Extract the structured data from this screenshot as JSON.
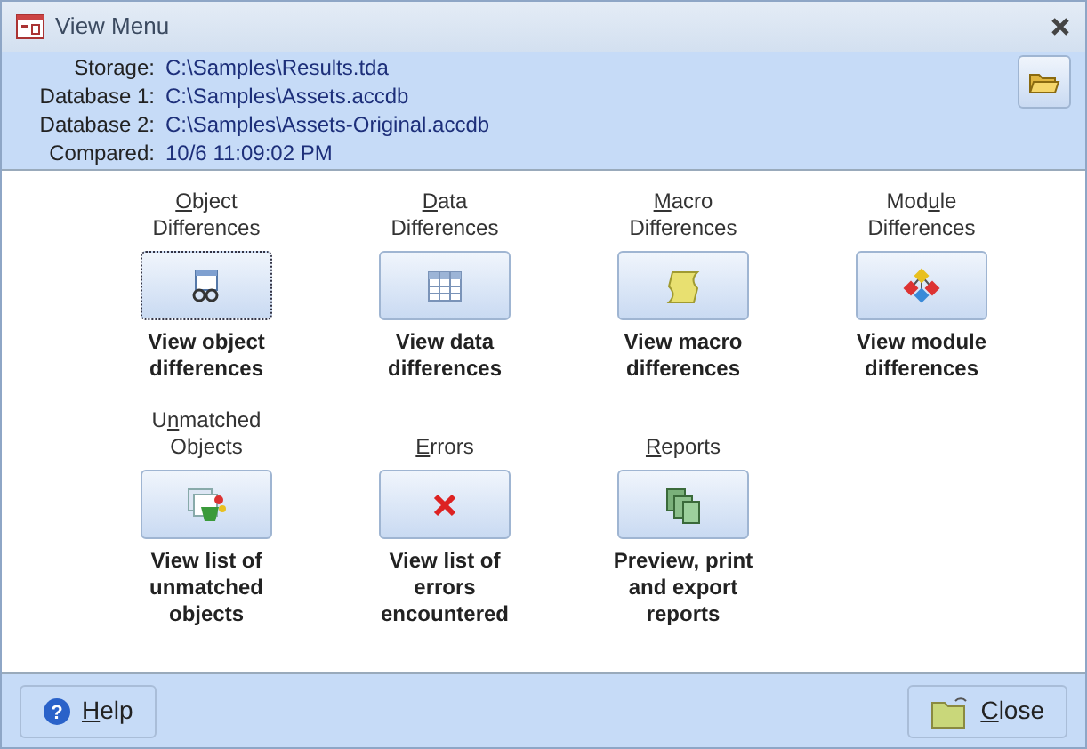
{
  "window": {
    "title": "View Menu"
  },
  "info": [
    {
      "label": "Storage:",
      "value": "C:\\Samples\\Results.tda"
    },
    {
      "label": "Database 1:",
      "value": "C:\\Samples\\Assets.accdb"
    },
    {
      "label": "Database 2:",
      "value": "C:\\Samples\\Assets-Original.accdb"
    },
    {
      "label": "Compared:",
      "value": "10/6  11:09:02 PM"
    }
  ],
  "actions": [
    {
      "kind": "object",
      "title_lines": [
        [
          {
            "text": "O",
            "underlined": true
          },
          {
            "text": "bject",
            "underlined": false
          }
        ],
        [
          {
            "text": "Differences",
            "underlined": false
          }
        ]
      ],
      "focused": true,
      "description": "View object differences"
    },
    {
      "kind": "data",
      "title_lines": [
        [
          {
            "text": "D",
            "underlined": true
          },
          {
            "text": "ata",
            "underlined": false
          }
        ],
        [
          {
            "text": "Differences",
            "underlined": false
          }
        ]
      ],
      "focused": false,
      "description": "View data differences"
    },
    {
      "kind": "macro",
      "title_lines": [
        [
          {
            "text": "M",
            "underlined": true
          },
          {
            "text": "acro",
            "underlined": false
          }
        ],
        [
          {
            "text": "Differences",
            "underlined": false
          }
        ]
      ],
      "focused": false,
      "description": "View macro differences"
    },
    {
      "kind": "module",
      "title_lines": [
        [
          {
            "text": "Mod",
            "underlined": false
          },
          {
            "text": "u",
            "underlined": true
          },
          {
            "text": "le",
            "underlined": false
          }
        ],
        [
          {
            "text": "Differences",
            "underlined": false
          }
        ]
      ],
      "focused": false,
      "description": "View module differences"
    },
    {
      "kind": "unmatched",
      "title_lines": [
        [
          {
            "text": "U",
            "underlined": false
          },
          {
            "text": "n",
            "underlined": true
          },
          {
            "text": "matched",
            "underlined": false
          }
        ],
        [
          {
            "text": "Objects",
            "underlined": false
          }
        ]
      ],
      "focused": false,
      "description": "View list of unmatched objects"
    },
    {
      "kind": "errors",
      "title_lines": [
        [
          {
            "text": "E",
            "underlined": true
          },
          {
            "text": "rrors",
            "underlined": false
          }
        ]
      ],
      "focused": false,
      "description": "View list of errors encountered"
    },
    {
      "kind": "reports",
      "title_lines": [
        [
          {
            "text": "R",
            "underlined": true
          },
          {
            "text": "eports",
            "underlined": false
          }
        ]
      ],
      "focused": false,
      "description": "Preview, print and export reports"
    }
  ],
  "footer": {
    "help": {
      "icon_glyph": "?",
      "label": [
        {
          "text": "H",
          "underlined": true
        },
        {
          "text": "elp",
          "underlined": false
        }
      ]
    },
    "close": {
      "label": [
        {
          "text": "C",
          "underlined": true
        },
        {
          "text": "lose",
          "underlined": false
        }
      ]
    }
  }
}
